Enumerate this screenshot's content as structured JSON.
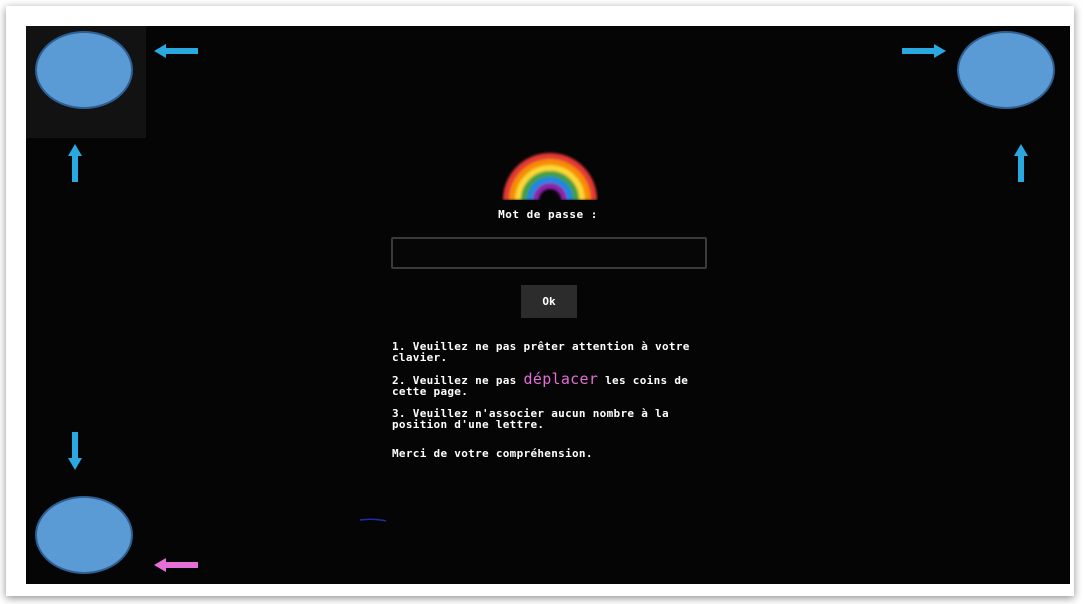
{
  "login": {
    "label": "Mot de passe :",
    "password_value": "",
    "ok_label": "Ok"
  },
  "instructions": {
    "item1": "1. Veuillez ne pas prêter attention à votre clavier.",
    "item2_before": "2. Veuillez ne pas ",
    "item2_highlight": "déplacer",
    "item2_after": " les coins de cette page.",
    "item3": "3. Veuillez n'associer aucun nombre à la position d'une lettre.",
    "thanks": "Merci de votre compréhension."
  },
  "icons": {
    "logo": "rainbow-icon",
    "arrows": [
      "arrow-left-icon",
      "arrow-right-icon",
      "arrow-up-icon",
      "arrow-down-icon"
    ]
  },
  "colors": {
    "background": "#050505",
    "corner_circle": "#5b9bd5",
    "arrow_blue": "#29a9e0",
    "arrow_pink": "#e46fd7",
    "highlight_pink": "#e46fd7"
  }
}
